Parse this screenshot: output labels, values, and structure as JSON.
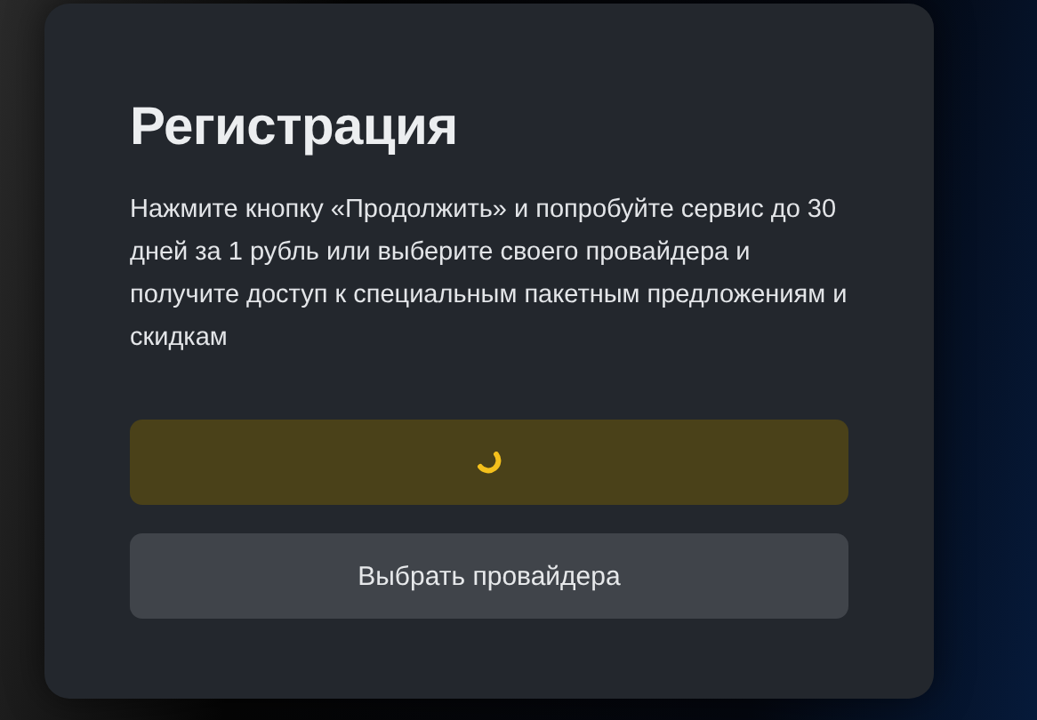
{
  "dialog": {
    "title": "Регистрация",
    "description": "Нажмите кнопку «Продолжить» и попробуйте сервис до 30 дней за 1 рубль или выберите своего провайдера и получите доступ к специальным пакетным предложениям и скидкам"
  },
  "buttons": [
    {
      "kind": "primary",
      "loading": true
    },
    {
      "kind": "secondary",
      "label": "Выбрать провайдера"
    }
  ]
}
